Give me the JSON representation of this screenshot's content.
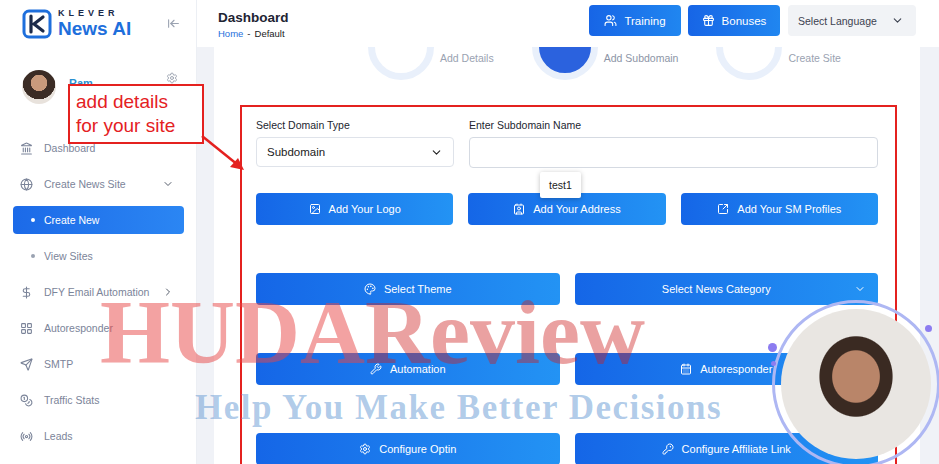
{
  "logo": {
    "brand": "KLEVER",
    "product": "News AI"
  },
  "header": {
    "title": "Dashboard",
    "breadcrumb": [
      "Home",
      "Default"
    ],
    "separator": "-",
    "buttons": [
      "Training",
      "Bonuses"
    ],
    "language": {
      "placeholder": "Select Language"
    }
  },
  "user": {
    "name": "Ram",
    "status": "online"
  },
  "sidebar": {
    "items": [
      {
        "label": "Dashboard",
        "kind": "item",
        "selected": false
      },
      {
        "label": "Create News Site",
        "kind": "group",
        "expanded": true,
        "selected": false
      },
      {
        "label": "Create New",
        "kind": "sub",
        "selected": true
      },
      {
        "label": "View Sites",
        "kind": "sub",
        "selected": false
      },
      {
        "label": "DFY Email Automation",
        "kind": "group",
        "expanded": false,
        "selected": false
      },
      {
        "label": "Autoresponder",
        "kind": "item",
        "selected": false
      },
      {
        "label": "SMTP",
        "kind": "item",
        "selected": false
      },
      {
        "label": "Traffic Stats",
        "kind": "item",
        "selected": false
      },
      {
        "label": "Leads",
        "kind": "item",
        "selected": false
      }
    ]
  },
  "stepper": {
    "steps": [
      {
        "label": "Add Details",
        "selected": false
      },
      {
        "label": "Add Subdomain",
        "selected": true
      },
      {
        "label": "Create Site",
        "selected": false
      }
    ]
  },
  "form": {
    "domain_type": {
      "label": "Select Domain Type",
      "value": "Subdomain"
    },
    "subdomain": {
      "label": "Enter Subdomain Name",
      "value": "",
      "suggestion": "test1"
    },
    "button_rows": [
      [
        {
          "label": "Add Your Logo",
          "kind": "button"
        },
        {
          "label": "Add Your Address",
          "kind": "button"
        },
        {
          "label": "Add Your SM Profiles",
          "kind": "button"
        }
      ],
      [
        {
          "label": "Select Theme",
          "kind": "button"
        },
        {
          "label": "Select News Category",
          "kind": "dropdown"
        }
      ],
      [
        {
          "label": "Automation",
          "kind": "button"
        },
        {
          "label": "Autoresponder",
          "kind": "button"
        }
      ],
      [
        {
          "label": "Configure Optin",
          "kind": "button"
        },
        {
          "label": "Configure Affiliate Link",
          "kind": "button"
        }
      ]
    ]
  },
  "annotation": {
    "lines": [
      "add details",
      "for your site"
    ]
  },
  "watermark": {
    "brand": [
      "HUDA",
      "Review"
    ],
    "tagline": "Help You Make Better Decisions"
  }
}
